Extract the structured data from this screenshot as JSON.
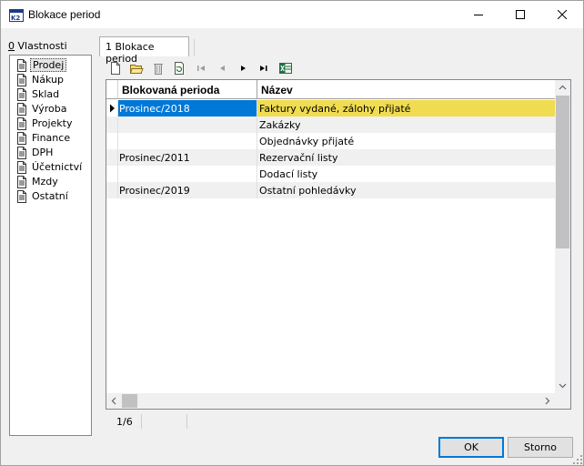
{
  "window": {
    "title": "Blokace period",
    "app_icon": "k2-app-icon"
  },
  "sidebar": {
    "label_prefix": "0",
    "label_rest": " Vlastnosti",
    "items": [
      {
        "label": "Prodej",
        "icon": "document-icon",
        "selected": true
      },
      {
        "label": "Nákup",
        "icon": "document-icon"
      },
      {
        "label": "Sklad",
        "icon": "document-icon"
      },
      {
        "label": "Výroba",
        "icon": "document-icon"
      },
      {
        "label": "Projekty",
        "icon": "document-icon"
      },
      {
        "label": "Finance",
        "icon": "document-icon"
      },
      {
        "label": "DPH",
        "icon": "document-icon"
      },
      {
        "label": "Účetnictví",
        "icon": "document-icon"
      },
      {
        "label": "Mzdy",
        "icon": "document-icon"
      },
      {
        "label": "Ostatní",
        "icon": "document-icon"
      }
    ]
  },
  "tabs": [
    {
      "label": "1 Blokace period",
      "active": true
    }
  ],
  "toolbar": {
    "icons": [
      "new-icon",
      "open-folder-icon",
      "delete-icon",
      "refresh-icon",
      "first-record-icon",
      "previous-record-icon",
      "next-record-icon",
      "last-record-icon",
      "excel-export-icon"
    ]
  },
  "grid": {
    "columns": [
      "Blokovaná perioda",
      "Název"
    ],
    "rows": [
      {
        "period": "Prosinec/2018",
        "name": "Faktury vydané, zálohy přijaté",
        "selected": true
      },
      {
        "period": "",
        "name": "Zakázky"
      },
      {
        "period": "",
        "name": "Objednávky přijaté"
      },
      {
        "period": "Prosinec/2011",
        "name": "Rezervační listy"
      },
      {
        "period": "",
        "name": "Dodací listy"
      },
      {
        "period": "Prosinec/2019",
        "name": "Ostatní pohledávky"
      }
    ]
  },
  "status": {
    "record_position": "1/6"
  },
  "buttons": {
    "ok": "OK",
    "cancel": "Storno"
  },
  "colors": {
    "selection_blue": "#0078d7",
    "selection_yellow": "#f0dc50"
  }
}
